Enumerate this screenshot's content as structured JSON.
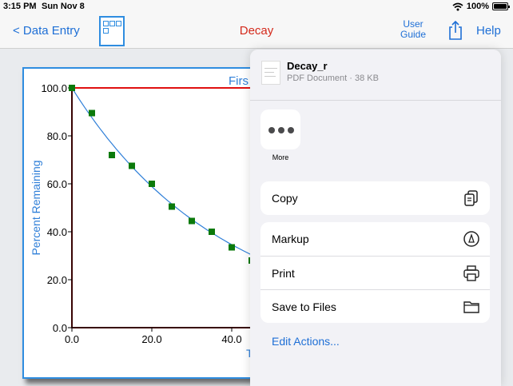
{
  "status": {
    "time": "3:15 PM",
    "date": "Sun Nov 8",
    "battery": "100%",
    "battery_level": 1.0
  },
  "nav": {
    "back_label": "< Data Entry",
    "title": "Decay",
    "user_guide_line1": "User",
    "user_guide_line2": "Guide",
    "help_label": "Help",
    "share_icon": "share-icon",
    "doc_icon": "document-grid-icon"
  },
  "colors": {
    "accent": "#1e6fd6",
    "title_red": "#d42a1c",
    "axis_red": "#e01010",
    "point_green": "#0b7a0b",
    "curve_blue": "#2f7fd8"
  },
  "chart_data": {
    "type": "scatter",
    "title": "Firs",
    "ylabel": "Percent Remaining",
    "xlabel": "T",
    "xlim": [
      0,
      60
    ],
    "ylim": [
      0,
      100
    ],
    "x_ticks": [
      "0.0",
      "20.0",
      "40.0"
    ],
    "y_ticks": [
      "0.0",
      "20.0",
      "40.0",
      "60.0",
      "80.0",
      "100.0"
    ],
    "grid": false,
    "series": [
      {
        "points": [
          [
            0,
            100
          ],
          [
            5,
            89.5
          ],
          [
            10,
            72
          ],
          [
            15,
            67.5
          ],
          [
            20,
            60
          ],
          [
            25,
            50.5
          ],
          [
            30,
            44.5
          ],
          [
            35,
            40
          ],
          [
            40,
            33.5
          ],
          [
            45,
            28
          ]
        ]
      }
    ],
    "fit_curve": {
      "form": "exponential",
      "a": 100,
      "k": 0.0265
    }
  },
  "share_sheet": {
    "file_name": "Decay_r",
    "file_meta": "PDF Document · 38 KB",
    "more_label": "More",
    "copy_label": "Copy",
    "markup_label": "Markup",
    "print_label": "Print",
    "save_label": "Save to Files",
    "edit_actions_label": "Edit Actions..."
  }
}
